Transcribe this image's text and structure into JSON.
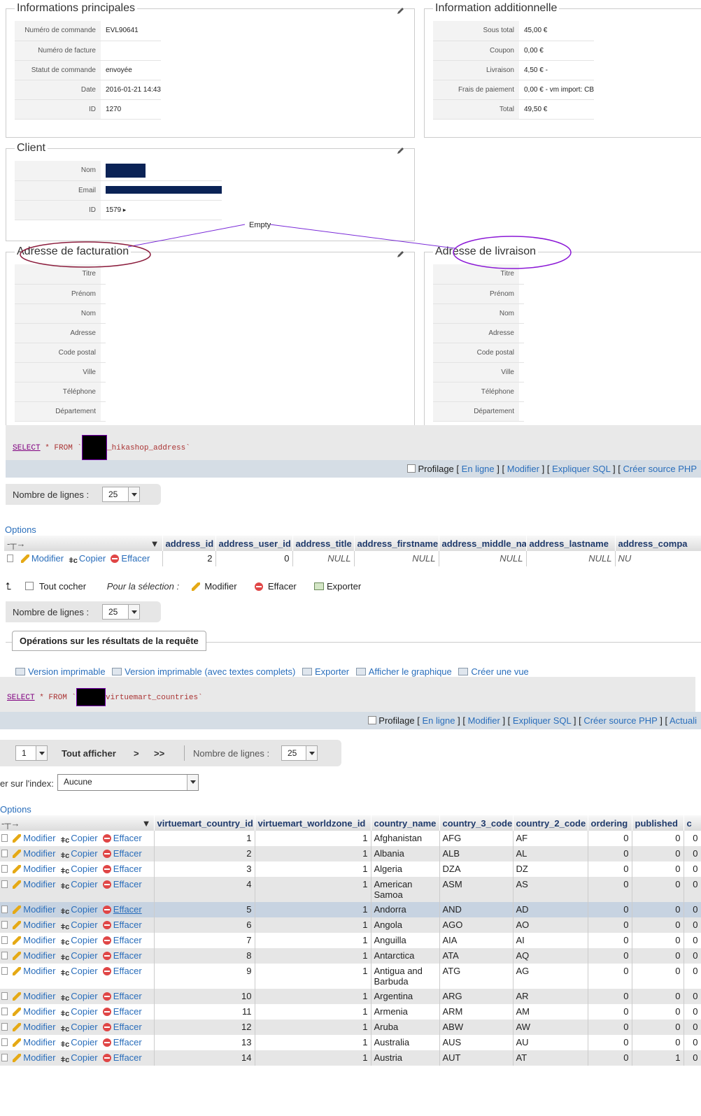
{
  "order": {
    "main": {
      "title": "Informations principales",
      "rows": [
        {
          "label": "Numéro de commande",
          "value": "EVL90641"
        },
        {
          "label": "Numéro de facture",
          "value": ""
        },
        {
          "label": "Statut de commande",
          "value": "envoyée"
        },
        {
          "label": "Date",
          "value": "2016-01-21 14:43"
        },
        {
          "label": "ID",
          "value": "1270"
        }
      ]
    },
    "additional": {
      "title": "Information additionnelle",
      "rows": [
        {
          "label": "Sous total",
          "value": "45,00 €"
        },
        {
          "label": "Coupon",
          "value": "0,00 €"
        },
        {
          "label": "Livraison",
          "value": "4,50 € -"
        },
        {
          "label": "Frais de paiement",
          "value": "0,00 € - vm import: CB"
        },
        {
          "label": "Total",
          "value": "49,50 €"
        }
      ]
    },
    "client": {
      "title": "Client",
      "rows": [
        {
          "label": "Nom",
          "value": ""
        },
        {
          "label": "Email",
          "value": ""
        },
        {
          "label": "ID",
          "value": "1579"
        }
      ]
    },
    "annotation": "Empty",
    "billing": {
      "title": "Adresse de facturation",
      "labels": [
        "Titre",
        "Prénom",
        "Nom",
        "Adresse",
        "Code postal",
        "Ville",
        "Téléphone",
        "Département"
      ]
    },
    "shipping": {
      "title": "Adresse de livraison",
      "labels": [
        "Titre",
        "Prénom",
        "Nom",
        "Adresse",
        "Code postal",
        "Ville",
        "Téléphone",
        "Département"
      ]
    }
  },
  "pma": {
    "query1": {
      "select": "SELECT",
      "rest": " * FROM `",
      "table": "_hikashop_address`"
    },
    "query2": {
      "select": "SELECT",
      "rest": " * FROM `",
      "table": "virtuemart_countries`"
    },
    "toolbar": {
      "profilage": "Profilage",
      "open": "[",
      "inline": "En ligne",
      "sep": "] [",
      "modify": "Modifier",
      "explain": "Expliquer SQL",
      "php": "Créer source PHP",
      "close": "]",
      "refresh": "Actuali"
    },
    "rows_label": "Nombre de lignes :",
    "rows_value": "25",
    "options": "Options",
    "address_table": {
      "headers": [
        "address_id",
        "address_user_id",
        "address_title",
        "address_firstname",
        "address_middle_name",
        "address_lastname",
        "address_compa"
      ],
      "row": [
        "2",
        "0",
        "NULL",
        "NULL",
        "NULL",
        "NULL",
        "NU"
      ]
    },
    "actions": {
      "edit": "Modifier",
      "copy": "Copier",
      "delete": "Effacer"
    },
    "bulk": {
      "check_all": "Tout cocher",
      "for_selection": "Pour la sélection :",
      "edit": "Modifier",
      "delete": "Effacer",
      "export": "Exporter"
    },
    "ops_tab": "Opérations sur les résultats de la requête",
    "ops_links": [
      "Version imprimable",
      "Version imprimable (avec textes complets)",
      "Exporter",
      "Afficher le graphique",
      "Créer une vue"
    ],
    "pager": {
      "page": "1",
      "show_all": "Tout afficher",
      "next": ">",
      "last": ">>",
      "rows_label": "Nombre de lignes :",
      "rows_value": "25"
    },
    "sort": {
      "label": "er sur l'index:",
      "value": "Aucune"
    },
    "countries": {
      "headers": [
        "virtuemart_country_id",
        "virtuemart_worldzone_id",
        "country_name",
        "country_3_code",
        "country_2_code",
        "ordering",
        "published",
        "c"
      ],
      "rows": [
        [
          "1",
          "1",
          "Afghanistan",
          "AFG",
          "AF",
          "0",
          "0",
          "0"
        ],
        [
          "2",
          "1",
          "Albania",
          "ALB",
          "AL",
          "0",
          "0",
          "0"
        ],
        [
          "3",
          "1",
          "Algeria",
          "DZA",
          "DZ",
          "0",
          "0",
          "0"
        ],
        [
          "4",
          "1",
          "American Samoa",
          "ASM",
          "AS",
          "0",
          "0",
          "0"
        ],
        [
          "5",
          "1",
          "Andorra",
          "AND",
          "AD",
          "0",
          "0",
          "0"
        ],
        [
          "6",
          "1",
          "Angola",
          "AGO",
          "AO",
          "0",
          "0",
          "0"
        ],
        [
          "7",
          "1",
          "Anguilla",
          "AIA",
          "AI",
          "0",
          "0",
          "0"
        ],
        [
          "8",
          "1",
          "Antarctica",
          "ATA",
          "AQ",
          "0",
          "0",
          "0"
        ],
        [
          "9",
          "1",
          "Antigua and Barbuda",
          "ATG",
          "AG",
          "0",
          "0",
          "0"
        ],
        [
          "10",
          "1",
          "Argentina",
          "ARG",
          "AR",
          "0",
          "0",
          "0"
        ],
        [
          "11",
          "1",
          "Armenia",
          "ARM",
          "AM",
          "0",
          "0",
          "0"
        ],
        [
          "12",
          "1",
          "Aruba",
          "ABW",
          "AW",
          "0",
          "0",
          "0"
        ],
        [
          "13",
          "1",
          "Australia",
          "AUS",
          "AU",
          "0",
          "0",
          "0"
        ],
        [
          "14",
          "1",
          "Austria",
          "AUT",
          "AT",
          "0",
          "1",
          "0"
        ]
      ]
    }
  }
}
